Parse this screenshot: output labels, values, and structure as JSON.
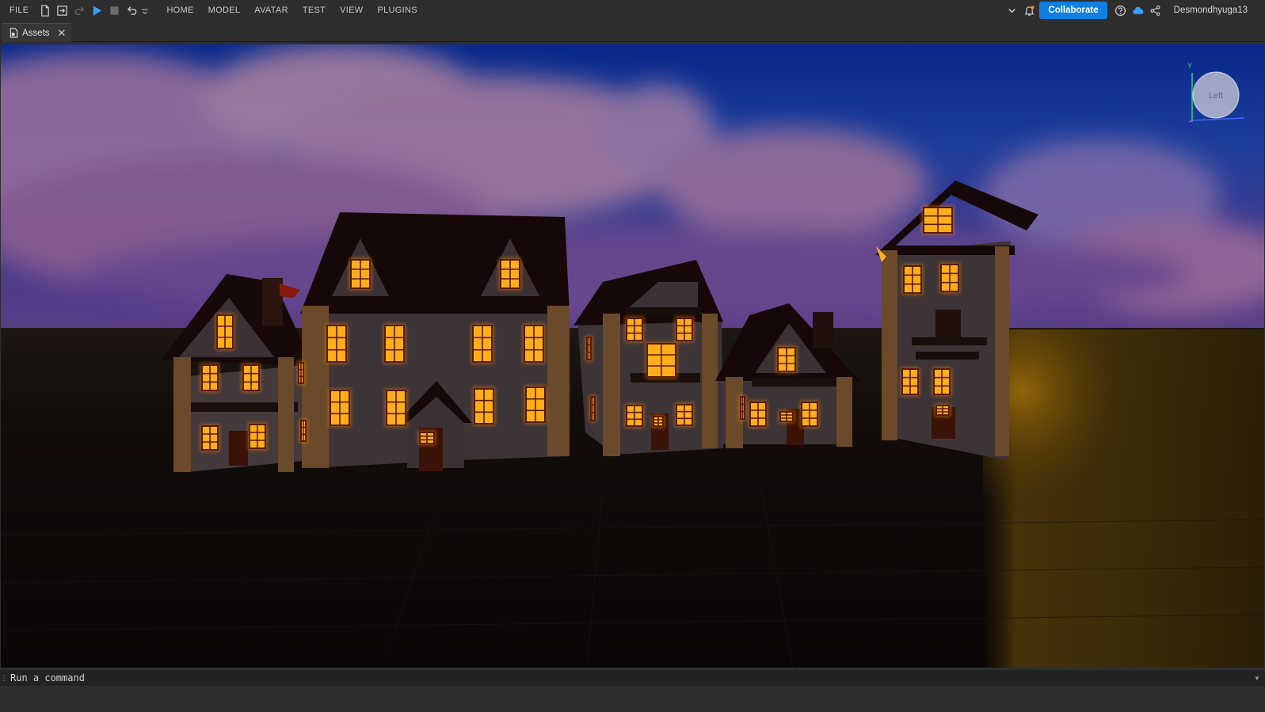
{
  "menu": {
    "file": "FILE",
    "tabs": [
      "HOME",
      "MODEL",
      "AVATAR",
      "TEST",
      "VIEW",
      "PLUGINS"
    ]
  },
  "toolbar_icons": [
    "new-file-icon",
    "publish-icon",
    "redo-icon",
    "play-icon",
    "stop-icon",
    "undo-icon",
    "customize-icon"
  ],
  "right_bar": {
    "collaborate_label": "Collaborate",
    "username": "Desmondhyuga13"
  },
  "tabs": [
    {
      "label": "Assets"
    }
  ],
  "viewport": {
    "view_cube_label": "Left",
    "axis_label": "Y"
  },
  "command_bar": {
    "placeholder": "Run a command"
  },
  "colors": {
    "accent": "#0f7fe0",
    "window_glow": "#ffae1a",
    "sky_top": "#0b2f8a",
    "sky_cloud": "#9a6a9c"
  }
}
